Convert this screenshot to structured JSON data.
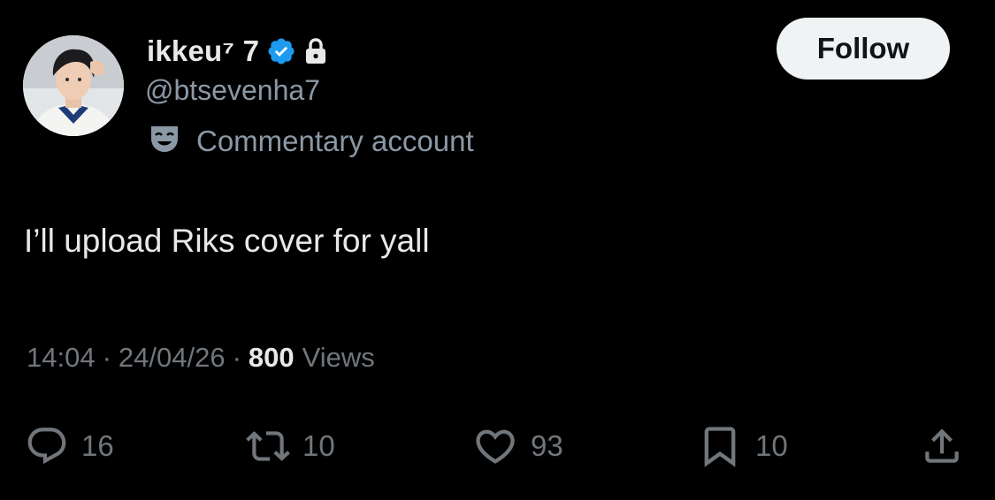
{
  "user": {
    "display_name": "ikkeu⁷ 7",
    "handle": "@btsevenha7",
    "account_label": "Commentary account",
    "verified_color": "#1d9bf0"
  },
  "follow_button": {
    "label": "Follow"
  },
  "tweet": {
    "text": "I’ll upload Riks cover for yall",
    "time": "14:04",
    "date": "24/04/26",
    "separator": "·",
    "views_count": "800",
    "views_label": "Views"
  },
  "actions": {
    "replies": {
      "icon": "reply-icon",
      "count": "16"
    },
    "retweets": {
      "icon": "retweet-icon",
      "count": "10"
    },
    "likes": {
      "icon": "heart-icon",
      "count": "93"
    },
    "bookmarks": {
      "icon": "bookmark-icon",
      "count": "10"
    },
    "share": {
      "icon": "share-icon"
    }
  },
  "colors": {
    "background": "#000000",
    "primary_text": "#e7e9ea",
    "secondary_text": "#71767b",
    "accent": "#1d9bf0"
  }
}
